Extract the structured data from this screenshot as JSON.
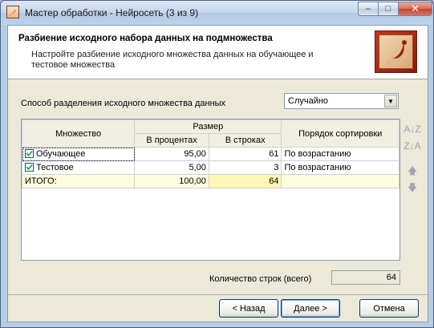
{
  "window": {
    "title": "Мастер обработки - Нейросеть (3 из 9)",
    "controls": {
      "minimize": "–",
      "maximize": "□",
      "close": "✕"
    }
  },
  "header": {
    "title": "Разбиение исходного набора данных на подмножества",
    "subtitle": "Настройте разбиение исходного множества данных на обучающее и тестовое множества",
    "logo_icon": "deductor-logo-icon"
  },
  "split": {
    "label": "Способ разделения исходного множества данных",
    "selected": "Случайно",
    "arrow": "▼"
  },
  "grid": {
    "headers": {
      "set": "Множество",
      "size": "Размер",
      "percent": "В процентах",
      "rows": "В строках",
      "sort": "Порядок сортировки"
    },
    "rows": [
      {
        "name": "Обучающее",
        "checked": true,
        "percent": "95,00",
        "rows": "61",
        "sort": "По возрастанию"
      },
      {
        "name": "Тестовое",
        "checked": true,
        "percent": "5,00",
        "rows": "3",
        "sort": "По возрастанию"
      }
    ],
    "total": {
      "name": "ИТОГО:",
      "percent": "100,00",
      "rows": "64",
      "sort": ""
    }
  },
  "side_tools": {
    "sort_asc": "A↓Z",
    "sort_desc": "Z↓A",
    "move_up": "🡅",
    "move_down": "🡇"
  },
  "rows_count": {
    "label": "Количество строк (всего)",
    "value": "64"
  },
  "buttons": {
    "back": "< Назад",
    "next": "Далее >",
    "cancel": "Отмена"
  }
}
